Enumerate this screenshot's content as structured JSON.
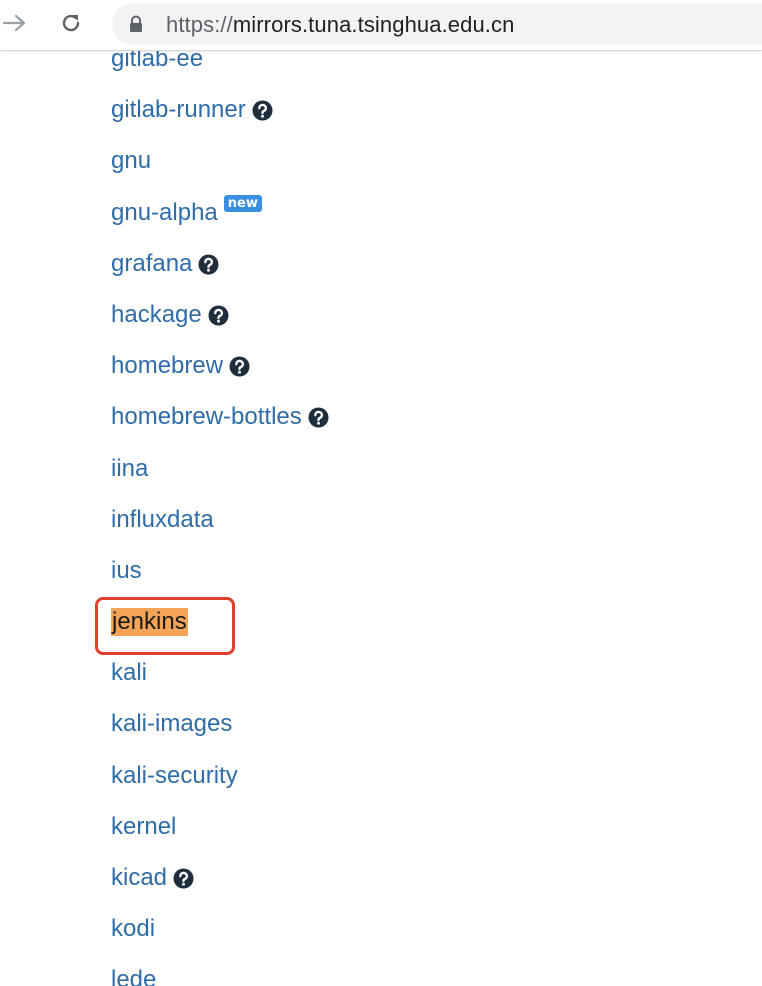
{
  "browser": {
    "url_protocol": "https://",
    "url_host": "mirrors.tuna.tsinghua.edu.cn"
  },
  "colors": {
    "link": "#2f6ca8",
    "highlight": "#f4a456",
    "badge": "#3a8fe0",
    "annotation": "#e0402e"
  },
  "mirrors": [
    {
      "name": "gitlab-ee",
      "help": false,
      "new": false
    },
    {
      "name": "gitlab-runner",
      "help": true,
      "new": false
    },
    {
      "name": "gnu",
      "help": false,
      "new": false
    },
    {
      "name": "gnu-alpha",
      "help": false,
      "new": true,
      "badge": "new"
    },
    {
      "name": "grafana",
      "help": true,
      "new": false
    },
    {
      "name": "hackage",
      "help": true,
      "new": false
    },
    {
      "name": "homebrew",
      "help": true,
      "new": false
    },
    {
      "name": "homebrew-bottles",
      "help": true,
      "new": false
    },
    {
      "name": "iina",
      "help": false,
      "new": false
    },
    {
      "name": "influxdata",
      "help": false,
      "new": false
    },
    {
      "name": "ius",
      "help": false,
      "new": false
    },
    {
      "name": "jenkins",
      "help": false,
      "new": false,
      "highlighted": true
    },
    {
      "name": "kali",
      "help": false,
      "new": false
    },
    {
      "name": "kali-images",
      "help": false,
      "new": false
    },
    {
      "name": "kali-security",
      "help": false,
      "new": false
    },
    {
      "name": "kernel",
      "help": false,
      "new": false
    },
    {
      "name": "kicad",
      "help": true,
      "new": false
    },
    {
      "name": "kodi",
      "help": false,
      "new": false
    },
    {
      "name": "lede",
      "help": false,
      "new": false
    }
  ],
  "icons": {
    "back": "arrow-right-icon",
    "reload": "reload-icon",
    "lock": "lock-icon",
    "help": "question-circle-icon"
  }
}
